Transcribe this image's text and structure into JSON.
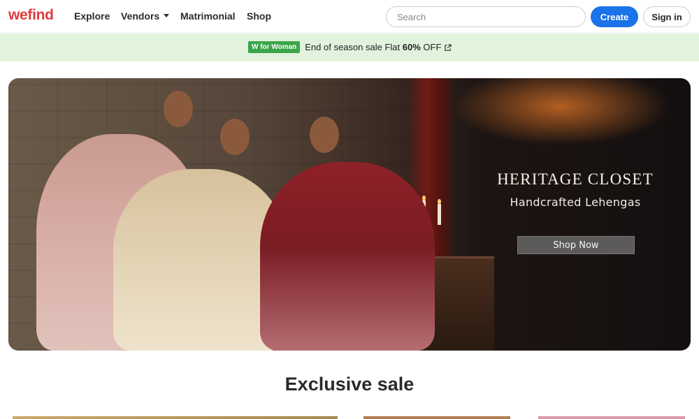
{
  "header": {
    "logo": "wefind",
    "nav": {
      "explore": "Explore",
      "vendors": "Vendors",
      "matrimonial": "Matrimonial",
      "shop": "Shop"
    },
    "search_placeholder": "Search",
    "create_label": "Create",
    "signin_label": "Sign in"
  },
  "promo": {
    "badge": "W for Woman",
    "text_before": "End of season sale Flat ",
    "text_bold": "60%",
    "text_after": " OFF"
  },
  "hero": {
    "title": "HERITAGE CLOSET",
    "subtitle": "Handcrafted Lehengas",
    "button": "Shop Now"
  },
  "section": {
    "title": "Exclusive sale"
  },
  "colors": {
    "brand": "#e03a3a",
    "primary": "#1a73e8",
    "promo_bg": "#e2f3dd",
    "promo_badge": "#3aa54a"
  },
  "icons": [
    "external-link-icon",
    "chevron-down-icon"
  ]
}
